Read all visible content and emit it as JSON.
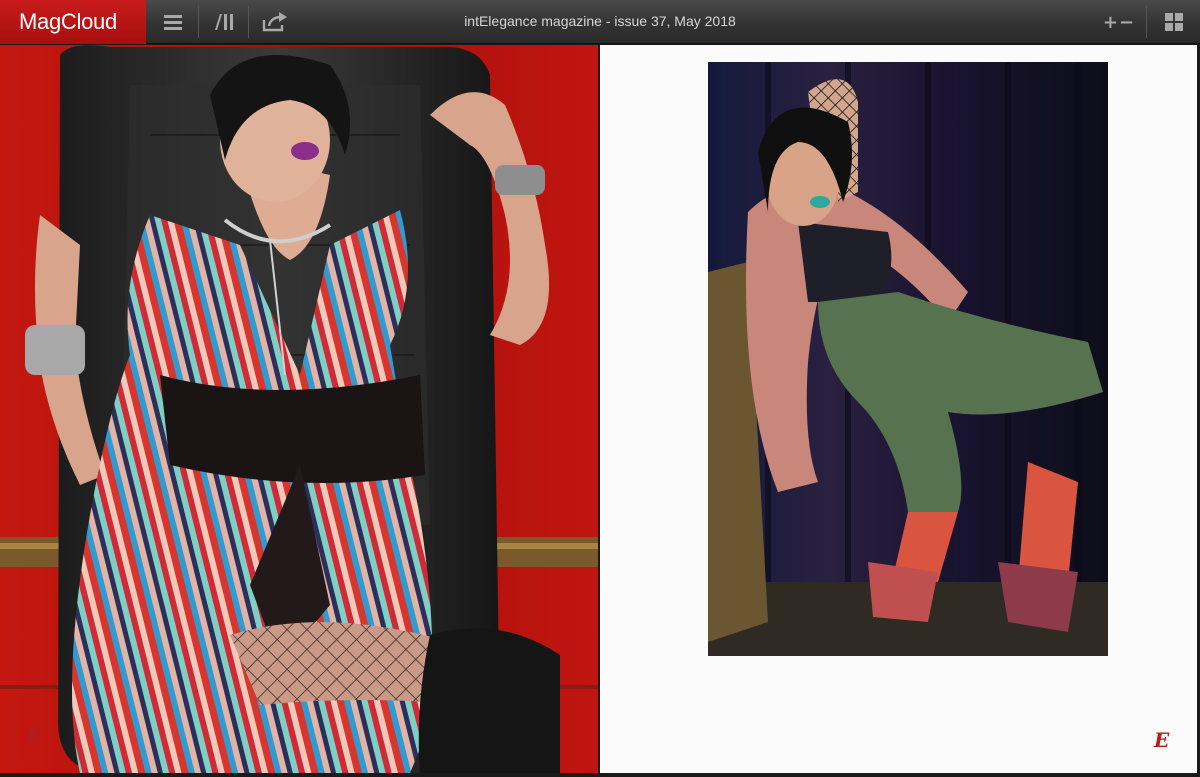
{
  "app": {
    "logo": "MagCloud",
    "document_title": "intElegance magazine - issue 37, May 2018"
  },
  "toolbar": {
    "left_icons": [
      "menu-icon",
      "library-icon",
      "share-icon"
    ],
    "right_icons": [
      "zoom-icon",
      "grid-view-icon"
    ],
    "zoom_label": "+−"
  },
  "spread": {
    "left_page": {
      "photo": "Model with purple lipstick in a striped sequin dress, black leather wrap belt, fishnet stockings and black boots, seated on a black leather chair against a red wall",
      "page_mark": "E"
    },
    "right_page": {
      "photo": "Model with blue lipstick wearing a pink fur stole, fishnet top, distressed green jeans and pink heels, lounging against a dark curtain",
      "page_mark": "E"
    }
  },
  "colors": {
    "brand_red": "#c81c1c",
    "toolbar_dark": "#333333",
    "page_white": "#fbfbfb"
  }
}
